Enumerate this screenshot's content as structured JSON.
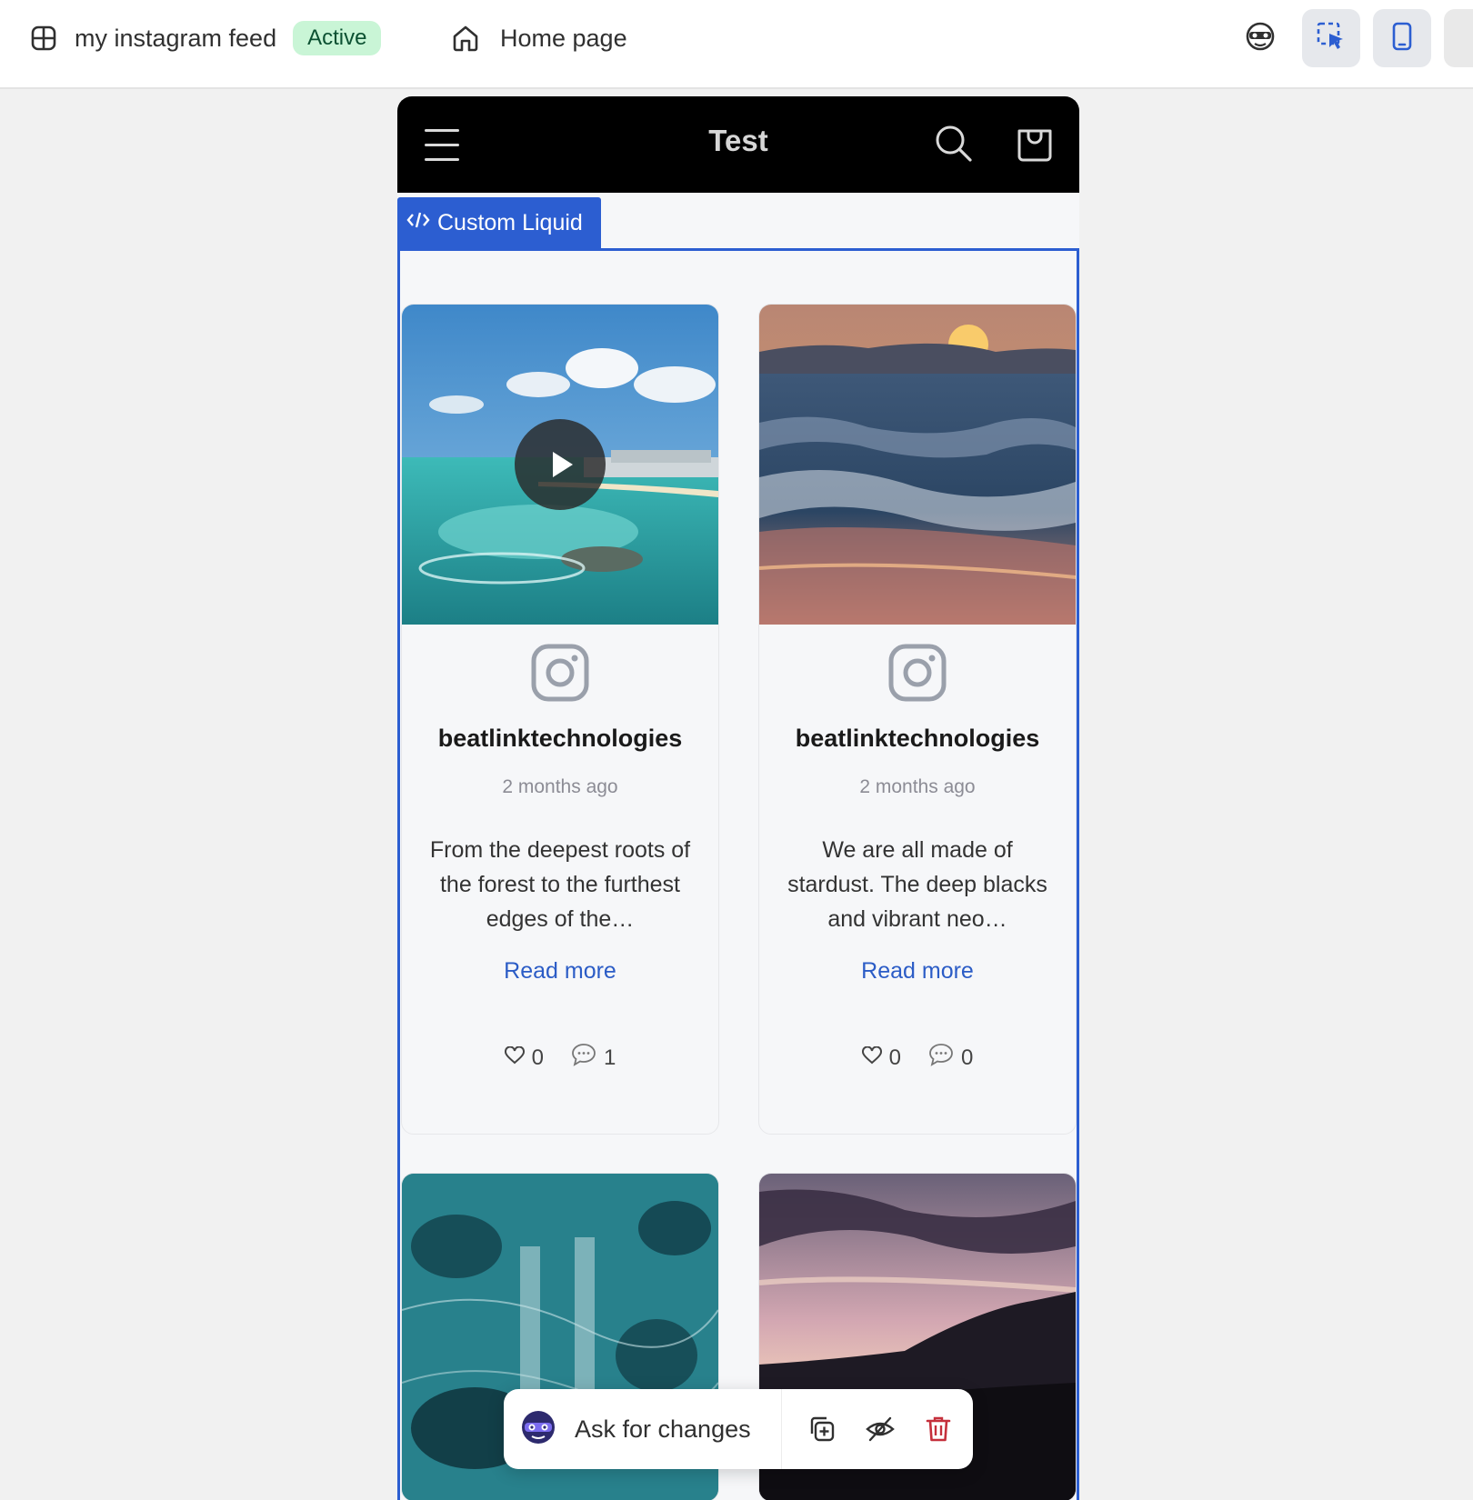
{
  "topbar": {
    "feed_name": "my instagram feed",
    "status": "Active",
    "page_name": "Home page"
  },
  "store": {
    "title": "Test"
  },
  "section": {
    "label": "Custom Liquid"
  },
  "posts": [
    {
      "author": "beatlinktechnologies",
      "time": "2 months ago",
      "caption": "From the deepest roots of the forest to the furthest edges of the…",
      "read_more": "Read more",
      "likes": "0",
      "comments": "1",
      "is_video": true
    },
    {
      "author": "beatlinktechnologies",
      "time": "2 months ago",
      "caption": "We are all made of stardust. The deep blacks and vibrant neo…",
      "read_more": "Read more",
      "likes": "0",
      "comments": "0",
      "is_video": false
    }
  ],
  "toolbar": {
    "ask_label": "Ask for changes"
  },
  "colors": {
    "accent": "#2c5ed1",
    "badge_bg": "#c9f5d6",
    "link": "#2b5cc6",
    "danger": "#c5303c"
  }
}
